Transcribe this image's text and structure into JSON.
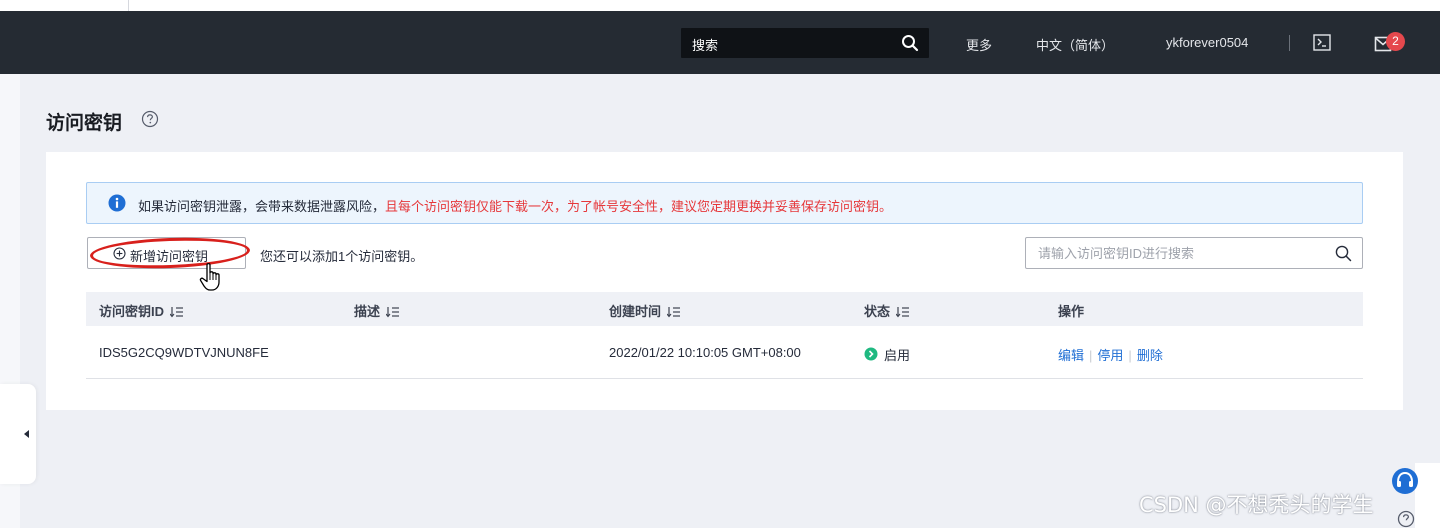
{
  "header": {
    "search_placeholder": "搜索",
    "more_label": "更多",
    "language_label": "中文（简体）",
    "username": "ykforever0504",
    "message_count": "2"
  },
  "page": {
    "title": "访问密钥"
  },
  "alert": {
    "normal_text": "如果访问密钥泄露，会带来数据泄露风险，",
    "warning_text": "且每个访问密钥仅能下载一次，为了帐号安全性，建议您定期更换并妥善保存访问密钥。"
  },
  "toolbar": {
    "add_button_label": "新增访问密钥",
    "remaining_text": "您还可以添加1个访问密钥。",
    "search_placeholder": "请输入访问密钥ID进行搜索"
  },
  "table": {
    "columns": [
      "访问密钥ID",
      "描述",
      "创建时间",
      "状态",
      "操作"
    ],
    "rows": [
      {
        "key_id": "IDS5G2CQ9WDTVJNUN8FE",
        "description": "",
        "created": "2022/01/22 10:10:05 GMT+08:00",
        "status": "启用",
        "actions": [
          "编辑",
          "停用",
          "删除"
        ]
      }
    ]
  },
  "watermark": "CSDN @不想秃头的学生",
  "colors": {
    "navbar": "#252b33",
    "link": "#1f6ed4",
    "warning_text": "#e6373a",
    "status_enabled": "#1fb981",
    "info_icon": "#1f6ed4",
    "highlight_ring": "#d8201c"
  }
}
